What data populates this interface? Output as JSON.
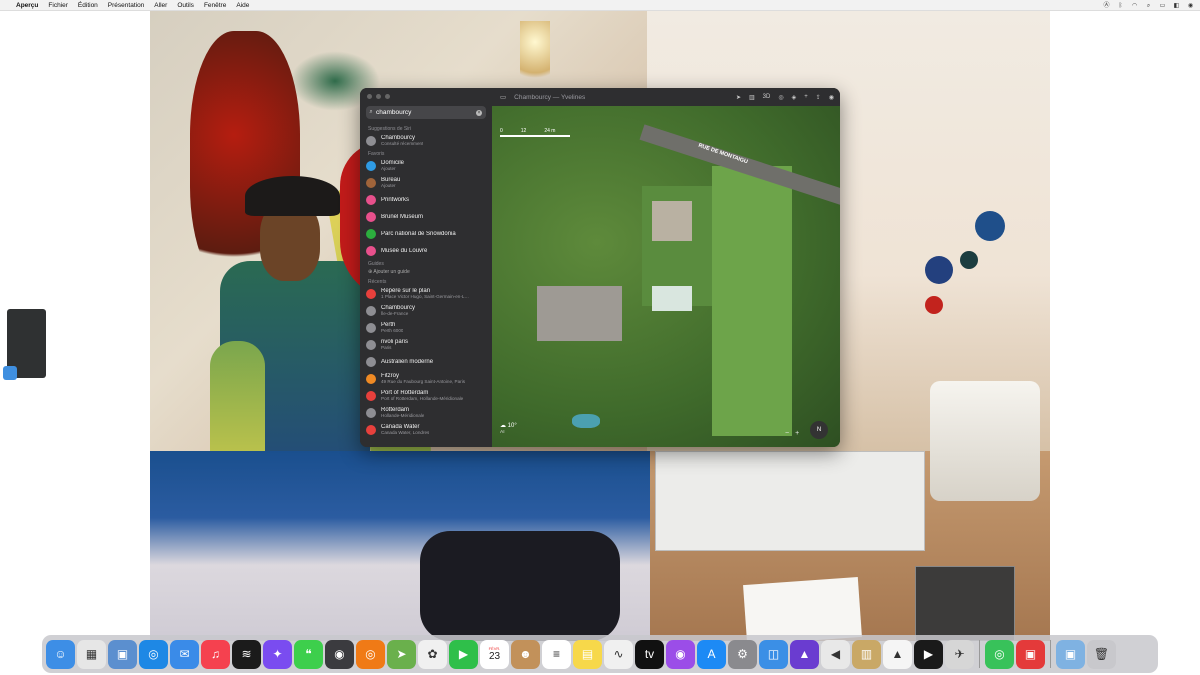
{
  "menubar": {
    "apple_icon": "apple-logo",
    "app_name": "Aperçu",
    "menus": [
      "Fichier",
      "Édition",
      "Présentation",
      "Aller",
      "Outils",
      "Fenêtre",
      "Aide"
    ],
    "status_icons": [
      "a-icon",
      "bluetooth-icon",
      "wifi-icon",
      "search-icon",
      "battery-icon",
      "control-center-icon",
      "siri-icon"
    ]
  },
  "maps_window": {
    "title": "Chambourcy — Yvelines",
    "search": {
      "value": "chambourcy"
    },
    "toolbar_labels": {
      "three_d": "3D"
    },
    "sections": {
      "siri": "Suggestions de Siri",
      "favorites": "Favoris",
      "guides": "Guides",
      "recents": "Récents"
    },
    "siri_items": [
      {
        "name": "Chambourcy",
        "sub": "Consulté récemment",
        "color": "#8e8e93"
      }
    ],
    "favorites": [
      {
        "name": "Domicile",
        "sub": "Ajouter",
        "color": "#2f9be4"
      },
      {
        "name": "Bureau",
        "sub": "Ajouter",
        "color": "#a0643a"
      },
      {
        "name": "Printworks",
        "sub": "",
        "color": "#e8508c"
      },
      {
        "name": "Brunel Museum",
        "sub": "",
        "color": "#e8508c"
      },
      {
        "name": "Parc national de Snowdonia",
        "sub": "",
        "color": "#2cae3e"
      },
      {
        "name": "Musée du Louvre",
        "sub": "",
        "color": "#e8508c"
      }
    ],
    "add_guide": "Ajouter un guide",
    "recents": [
      {
        "name": "Repère sur le plan",
        "sub": "1 Place Victor Hugo, Saint-Germain-en-L…",
        "color": "#e8403c"
      },
      {
        "name": "Chambourcy",
        "sub": "Île-de-France",
        "color": "#8e8e93"
      },
      {
        "name": "Perth",
        "sub": "Perth 6000",
        "color": "#8e8e93"
      },
      {
        "name": "rivoli paris",
        "sub": "Paris",
        "color": "#8e8e93"
      },
      {
        "name": "Australien moderne",
        "sub": "",
        "color": "#8e8e93"
      },
      {
        "name": "Fitzroy",
        "sub": "49 Rue du Faubourg Saint-Antoine, Paris",
        "color": "#f08a24"
      },
      {
        "name": "Port of Rotterdam",
        "sub": "Port of Rotterdam, Hollande-Méridionale",
        "color": "#e8403c"
      },
      {
        "name": "Rotterdam",
        "sub": "Hollande-Méridionale",
        "color": "#8e8e93"
      },
      {
        "name": "Canada Water",
        "sub": "Canada Water, Londres",
        "color": "#e8403c"
      }
    ],
    "map": {
      "scale_labels": [
        "0",
        "12",
        "24 m"
      ],
      "road_label": "RUE DE MONTAIGU",
      "weather_temp": "10°",
      "air_quality": "AI",
      "compass": "N",
      "zoom_out": "−",
      "zoom_in": "+"
    }
  },
  "dock": {
    "apps": [
      {
        "name": "finder",
        "color": "#3d8ee6",
        "glyph": "☺"
      },
      {
        "name": "launchpad",
        "color": "#e6e6e6",
        "glyph": "▦"
      },
      {
        "name": "preview",
        "color": "#5b8fcf",
        "glyph": "▣"
      },
      {
        "name": "safari",
        "color": "#1e88e5",
        "glyph": "◎"
      },
      {
        "name": "mail",
        "color": "#3a8be8",
        "glyph": "✉"
      },
      {
        "name": "music",
        "color": "#f5414f",
        "glyph": "♫"
      },
      {
        "name": "spotify",
        "color": "#1b1b1b",
        "glyph": "≋"
      },
      {
        "name": "messenger",
        "color": "#7a4cf0",
        "glyph": "✦"
      },
      {
        "name": "messages",
        "color": "#3dcf4c",
        "glyph": "❝"
      },
      {
        "name": "disk-utility",
        "color": "#3b3b3f",
        "glyph": "◉"
      },
      {
        "name": "app-orange",
        "color": "#f07a16",
        "glyph": "◎"
      },
      {
        "name": "maps",
        "color": "#6ab04c",
        "glyph": "➤"
      },
      {
        "name": "photos",
        "color": "#f0f0f0",
        "glyph": "✿"
      },
      {
        "name": "facetime",
        "color": "#2fbf4a",
        "glyph": "▶"
      },
      {
        "name": "calendar",
        "color": "#ffffff",
        "glyph": "23"
      },
      {
        "name": "contacts",
        "color": "#c2915a",
        "glyph": "☻"
      },
      {
        "name": "reminders",
        "color": "#ffffff",
        "glyph": "≡"
      },
      {
        "name": "notes",
        "color": "#f7d84a",
        "glyph": "▤"
      },
      {
        "name": "freeform",
        "color": "#f0f0f0",
        "glyph": "∿"
      },
      {
        "name": "apple-tv",
        "color": "#111111",
        "glyph": "tv"
      },
      {
        "name": "podcasts",
        "color": "#9b4de8",
        "glyph": "◉"
      },
      {
        "name": "app-store",
        "color": "#1d8af5",
        "glyph": "A"
      },
      {
        "name": "system-settings",
        "color": "#8a8a8e",
        "glyph": "⚙"
      },
      {
        "name": "app-blue-square",
        "color": "#3b8fe6",
        "glyph": "◫"
      },
      {
        "name": "affinity",
        "color": "#6a3cd0",
        "glyph": "▲"
      },
      {
        "name": "app-red-white",
        "color": "#e8e8e8",
        "glyph": "◀"
      },
      {
        "name": "archive-utility",
        "color": "#c9a866",
        "glyph": "▥"
      },
      {
        "name": "vlc",
        "color": "#f5f5f5",
        "glyph": "▲"
      },
      {
        "name": "infuse",
        "color": "#1a1a1a",
        "glyph": "▶"
      },
      {
        "name": "app-satellite",
        "color": "#d6d6d6",
        "glyph": "✈"
      },
      {
        "name": "find-my",
        "color": "#38c25a",
        "glyph": "◎"
      },
      {
        "name": "app-red-badge",
        "color": "#e43a3a",
        "glyph": "▣"
      },
      {
        "name": "downloads-folder",
        "color": "#7fb2e2",
        "glyph": "▣"
      },
      {
        "name": "trash",
        "color": "#c8c8cc",
        "glyph": "🗑"
      }
    ],
    "calendar": {
      "month": "FÉVR.",
      "day": "23"
    }
  }
}
